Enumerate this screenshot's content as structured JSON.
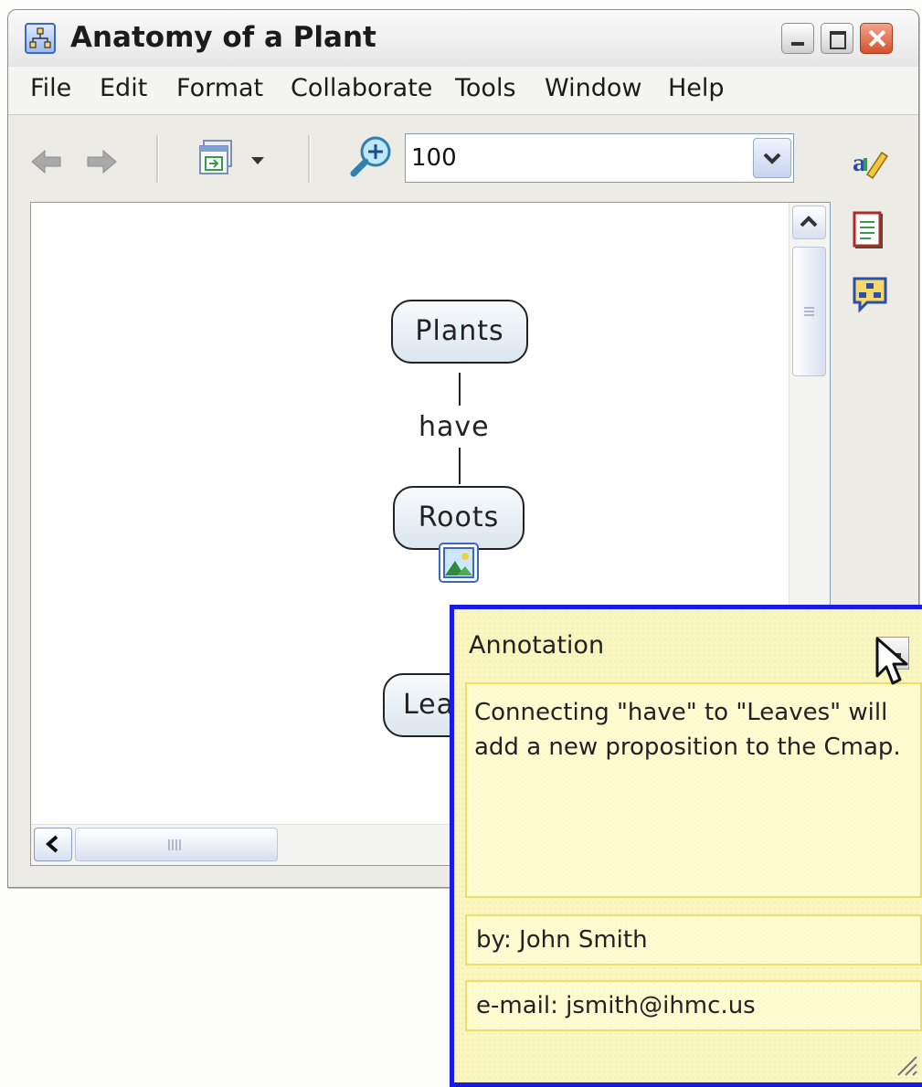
{
  "window": {
    "title": "Anatomy of a Plant"
  },
  "menu": [
    "File",
    "Edit",
    "Format",
    "Collaborate",
    "Tools",
    "Window",
    "Help"
  ],
  "toolbar": {
    "zoom_value": "100"
  },
  "map": {
    "concepts": {
      "plants": "Plants",
      "roots": "Roots",
      "leaves_partial": "Lea"
    },
    "link_label": "have"
  },
  "annotation": {
    "title": "Annotation",
    "body": "Connecting \"have\" to \"Leaves\" will add a new proposition to the Cmap.",
    "author": "by: John Smith",
    "email": "e-mail: jsmith@ihmc.us"
  },
  "colors": {
    "annotation_border": "#1a1ae6",
    "annotation_bg": "#f9f7bf",
    "concept_fill": "#e6eef4"
  },
  "icons": {
    "app": "cmap-app-icon",
    "back": "back-arrow-icon",
    "forward": "forward-arrow-icon",
    "view": "view-menu-icon",
    "zoom": "zoom-in-icon",
    "styles": "styles-palette-icon",
    "info": "info-panel-icon",
    "annotation": "annotation-icon",
    "resource": "image-resource-icon"
  }
}
